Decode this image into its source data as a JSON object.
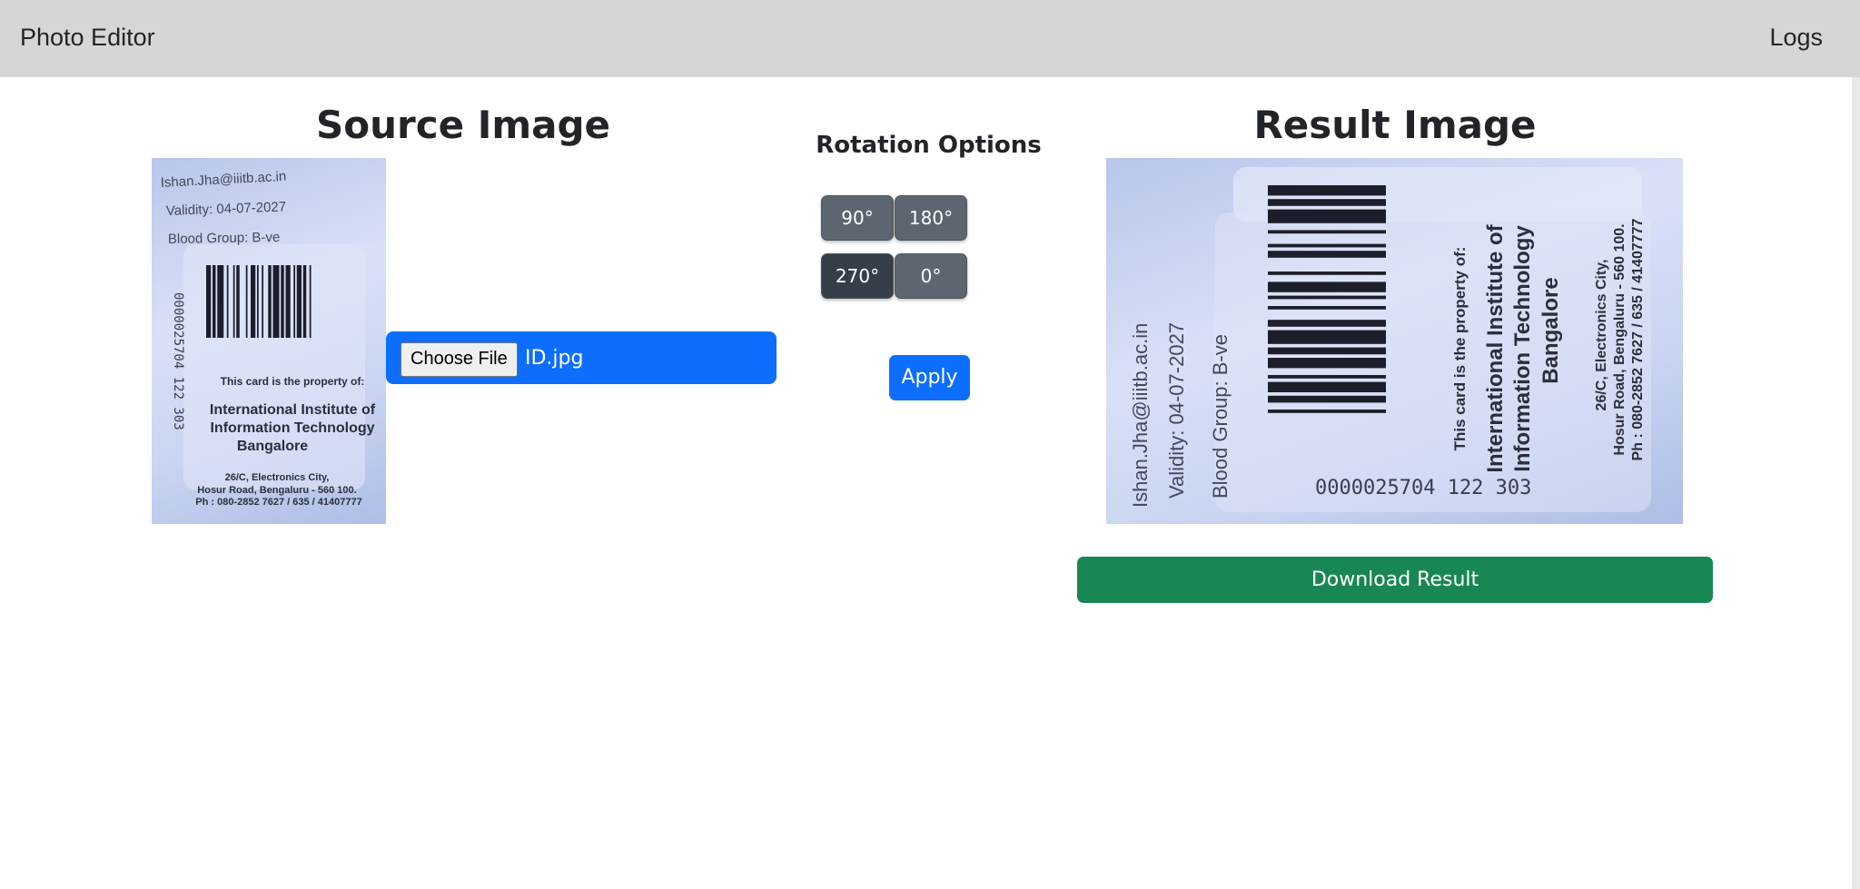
{
  "navbar": {
    "brand": "Photo Editor",
    "logs_label": "Logs"
  },
  "source": {
    "title": "Source Image"
  },
  "result": {
    "title": "Result Image",
    "download_label": "Download Result"
  },
  "file_input": {
    "button_label": "Choose File",
    "file_name": "ID.jpg"
  },
  "rotation": {
    "title": "Rotation Options",
    "options": [
      "90°",
      "180°",
      "270°",
      "0°"
    ],
    "selected": "270°",
    "apply_label": "Apply"
  },
  "card": {
    "email": "Ishan.Jha@iiitb.ac.in",
    "validity": "Validity: 04-07-2027",
    "blood_group": "Blood Group: B-ve",
    "barcode_number": "0000025704   122 303",
    "property_line": "This card is the property of:",
    "institute_1": "International Institute of",
    "institute_2": "Information Technology",
    "institute_3": "Bangalore",
    "address_1": "26/C, Electronics City,",
    "address_2": "Hosur Road, Bengaluru - 560 100.",
    "phone": "Ph : 080-2852 7627 / 635 / 41407777"
  },
  "colors": {
    "navbar": "#d6d6d6",
    "primary": "#0d6efd",
    "success": "#198754",
    "secondary": "#5c6670",
    "secondary_active": "#353f49"
  }
}
